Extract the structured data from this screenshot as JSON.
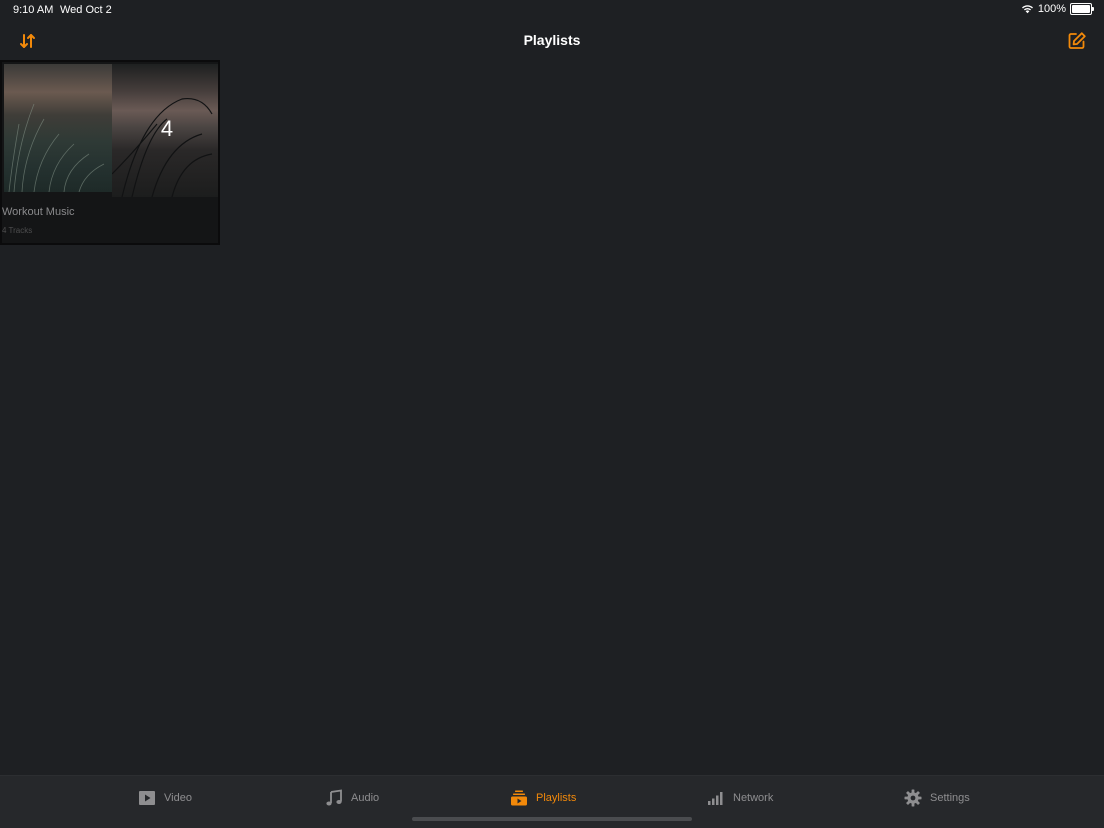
{
  "status_bar": {
    "time": "9:10 AM",
    "date": "Wed Oct 2",
    "battery": "100%",
    "battery_level": 1.0
  },
  "nav": {
    "title": "Playlists",
    "left_icon": "sort-icon",
    "right_icon": "edit-icon"
  },
  "playlists": [
    {
      "name": "Workout Music",
      "subtitle": "4 Tracks",
      "count": "4"
    }
  ],
  "tabs": [
    {
      "label": "Video",
      "icon": "video-icon",
      "active": false
    },
    {
      "label": "Audio",
      "icon": "music-note-icon",
      "active": false
    },
    {
      "label": "Playlists",
      "icon": "playlist-icon",
      "active": true
    },
    {
      "label": "Network",
      "icon": "network-icon",
      "active": false
    },
    {
      "label": "Settings",
      "icon": "gear-icon",
      "active": false
    }
  ],
  "colors": {
    "accent": "#f2890a",
    "background": "#1e2023",
    "tab_bar": "#26282b",
    "inactive": "#8e8e90"
  }
}
